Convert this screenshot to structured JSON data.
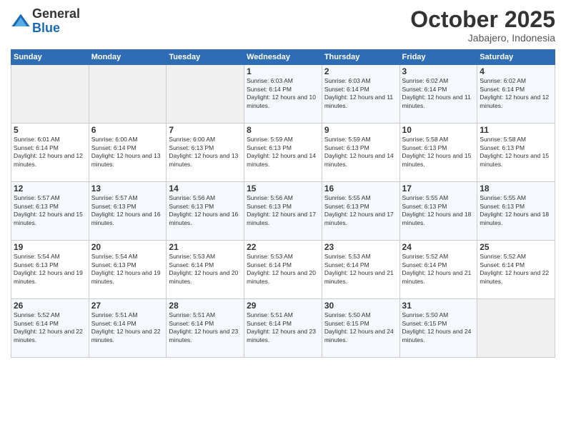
{
  "logo": {
    "general": "General",
    "blue": "Blue"
  },
  "header": {
    "month": "October 2025",
    "location": "Jabajero, Indonesia"
  },
  "days_of_week": [
    "Sunday",
    "Monday",
    "Tuesday",
    "Wednesday",
    "Thursday",
    "Friday",
    "Saturday"
  ],
  "weeks": [
    [
      {
        "day": "",
        "empty": true
      },
      {
        "day": "",
        "empty": true
      },
      {
        "day": "",
        "empty": true
      },
      {
        "day": "1",
        "sunrise": "6:03 AM",
        "sunset": "6:14 PM",
        "daylight": "12 hours and 10 minutes."
      },
      {
        "day": "2",
        "sunrise": "6:03 AM",
        "sunset": "6:14 PM",
        "daylight": "12 hours and 11 minutes."
      },
      {
        "day": "3",
        "sunrise": "6:02 AM",
        "sunset": "6:14 PM",
        "daylight": "12 hours and 11 minutes."
      },
      {
        "day": "4",
        "sunrise": "6:02 AM",
        "sunset": "6:14 PM",
        "daylight": "12 hours and 12 minutes."
      }
    ],
    [
      {
        "day": "5",
        "sunrise": "6:01 AM",
        "sunset": "6:14 PM",
        "daylight": "12 hours and 12 minutes."
      },
      {
        "day": "6",
        "sunrise": "6:00 AM",
        "sunset": "6:14 PM",
        "daylight": "12 hours and 13 minutes."
      },
      {
        "day": "7",
        "sunrise": "6:00 AM",
        "sunset": "6:13 PM",
        "daylight": "12 hours and 13 minutes."
      },
      {
        "day": "8",
        "sunrise": "5:59 AM",
        "sunset": "6:13 PM",
        "daylight": "12 hours and 14 minutes."
      },
      {
        "day": "9",
        "sunrise": "5:59 AM",
        "sunset": "6:13 PM",
        "daylight": "12 hours and 14 minutes."
      },
      {
        "day": "10",
        "sunrise": "5:58 AM",
        "sunset": "6:13 PM",
        "daylight": "12 hours and 15 minutes."
      },
      {
        "day": "11",
        "sunrise": "5:58 AM",
        "sunset": "6:13 PM",
        "daylight": "12 hours and 15 minutes."
      }
    ],
    [
      {
        "day": "12",
        "sunrise": "5:57 AM",
        "sunset": "6:13 PM",
        "daylight": "12 hours and 15 minutes."
      },
      {
        "day": "13",
        "sunrise": "5:57 AM",
        "sunset": "6:13 PM",
        "daylight": "12 hours and 16 minutes."
      },
      {
        "day": "14",
        "sunrise": "5:56 AM",
        "sunset": "6:13 PM",
        "daylight": "12 hours and 16 minutes."
      },
      {
        "day": "15",
        "sunrise": "5:56 AM",
        "sunset": "6:13 PM",
        "daylight": "12 hours and 17 minutes."
      },
      {
        "day": "16",
        "sunrise": "5:55 AM",
        "sunset": "6:13 PM",
        "daylight": "12 hours and 17 minutes."
      },
      {
        "day": "17",
        "sunrise": "5:55 AM",
        "sunset": "6:13 PM",
        "daylight": "12 hours and 18 minutes."
      },
      {
        "day": "18",
        "sunrise": "5:55 AM",
        "sunset": "6:13 PM",
        "daylight": "12 hours and 18 minutes."
      }
    ],
    [
      {
        "day": "19",
        "sunrise": "5:54 AM",
        "sunset": "6:13 PM",
        "daylight": "12 hours and 19 minutes."
      },
      {
        "day": "20",
        "sunrise": "5:54 AM",
        "sunset": "6:13 PM",
        "daylight": "12 hours and 19 minutes."
      },
      {
        "day": "21",
        "sunrise": "5:53 AM",
        "sunset": "6:14 PM",
        "daylight": "12 hours and 20 minutes."
      },
      {
        "day": "22",
        "sunrise": "5:53 AM",
        "sunset": "6:14 PM",
        "daylight": "12 hours and 20 minutes."
      },
      {
        "day": "23",
        "sunrise": "5:53 AM",
        "sunset": "6:14 PM",
        "daylight": "12 hours and 21 minutes."
      },
      {
        "day": "24",
        "sunrise": "5:52 AM",
        "sunset": "6:14 PM",
        "daylight": "12 hours and 21 minutes."
      },
      {
        "day": "25",
        "sunrise": "5:52 AM",
        "sunset": "6:14 PM",
        "daylight": "12 hours and 22 minutes."
      }
    ],
    [
      {
        "day": "26",
        "sunrise": "5:52 AM",
        "sunset": "6:14 PM",
        "daylight": "12 hours and 22 minutes."
      },
      {
        "day": "27",
        "sunrise": "5:51 AM",
        "sunset": "6:14 PM",
        "daylight": "12 hours and 22 minutes."
      },
      {
        "day": "28",
        "sunrise": "5:51 AM",
        "sunset": "6:14 PM",
        "daylight": "12 hours and 23 minutes."
      },
      {
        "day": "29",
        "sunrise": "5:51 AM",
        "sunset": "6:14 PM",
        "daylight": "12 hours and 23 minutes."
      },
      {
        "day": "30",
        "sunrise": "5:50 AM",
        "sunset": "6:15 PM",
        "daylight": "12 hours and 24 minutes."
      },
      {
        "day": "31",
        "sunrise": "5:50 AM",
        "sunset": "6:15 PM",
        "daylight": "12 hours and 24 minutes."
      },
      {
        "day": "",
        "empty": true
      }
    ]
  ]
}
